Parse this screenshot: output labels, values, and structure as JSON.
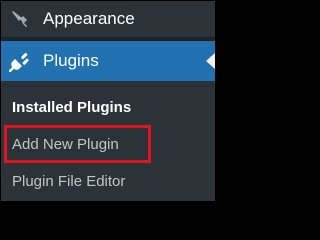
{
  "menu": {
    "appearance": {
      "label": "Appearance",
      "icon": "paintbrush-icon"
    },
    "plugins": {
      "label": "Plugins",
      "icon": "plugin-icon",
      "current": true
    }
  },
  "submenu": {
    "items": [
      {
        "label": "Installed Plugins",
        "current": true
      },
      {
        "label": "Add New Plugin",
        "highlighted": true
      },
      {
        "label": "Plugin File Editor"
      }
    ]
  },
  "colors": {
    "sidebar_bg": "#1d2327",
    "submenu_bg": "#2c3338",
    "accent": "#2271b1",
    "highlight_box": "#e0141e",
    "text": "#ffffff",
    "muted_text": "#c3c4c7"
  }
}
